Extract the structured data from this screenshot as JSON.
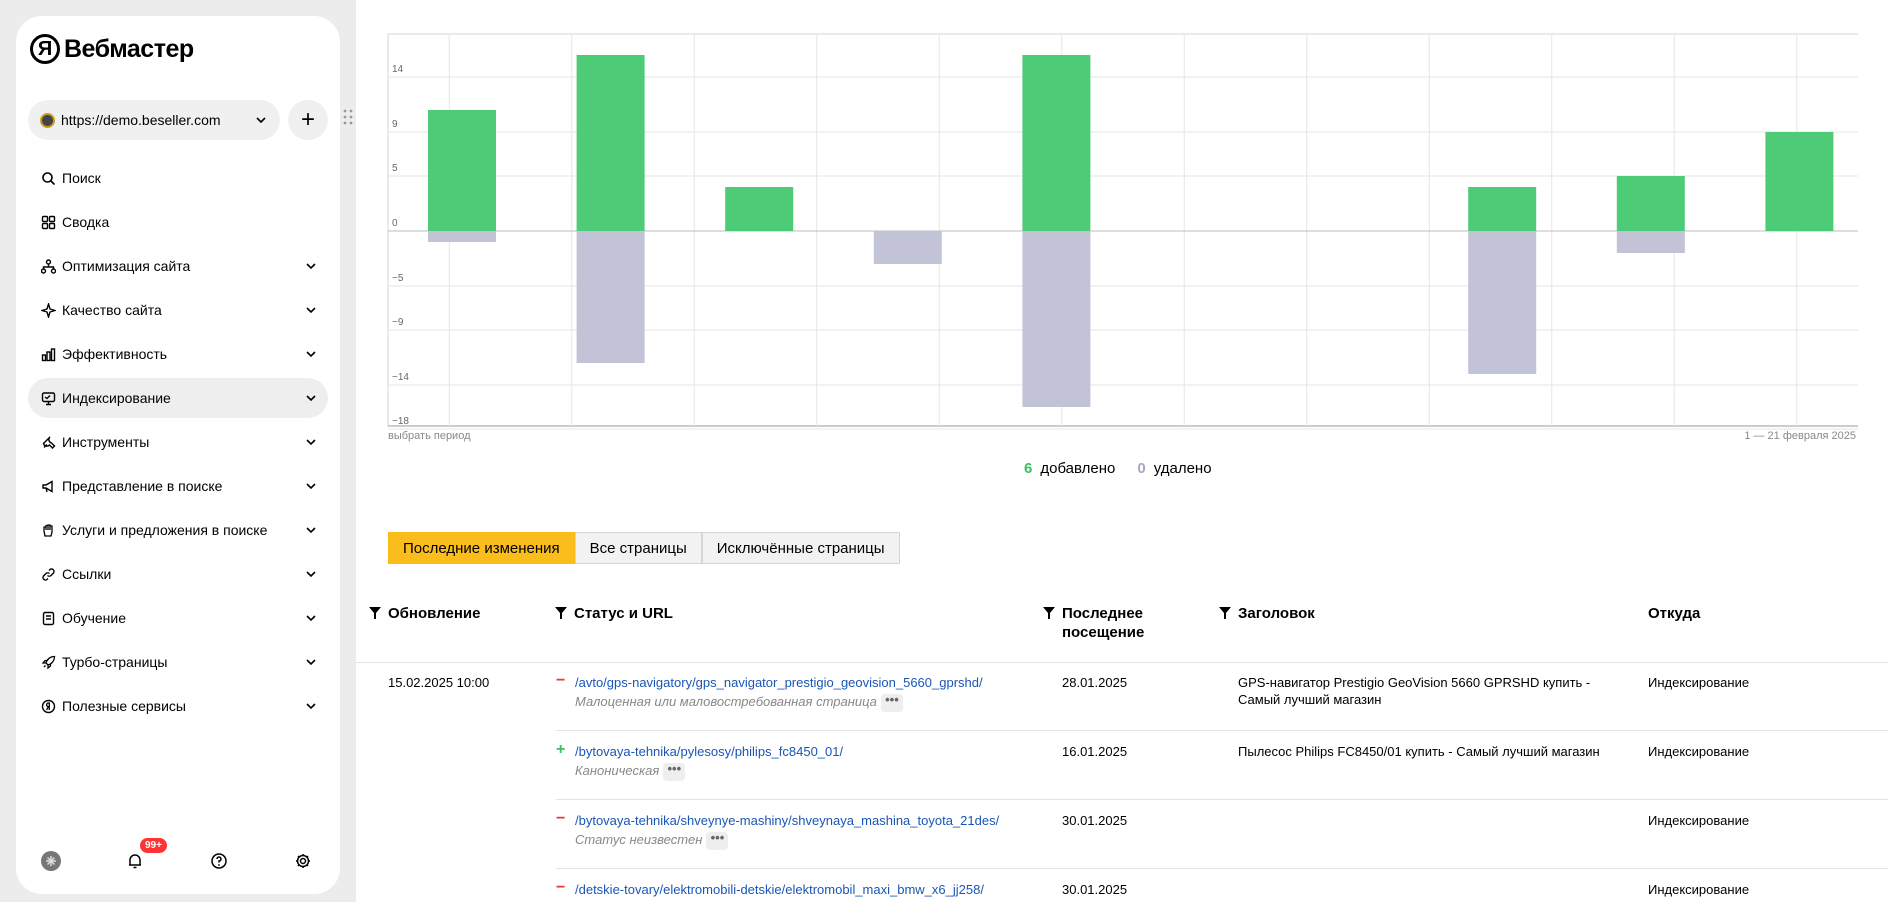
{
  "app": {
    "logo_letter": "Я",
    "logo_text": "Вебмастер"
  },
  "site": {
    "url": "https://demo.beseller.com",
    "add_label": "+"
  },
  "nav": [
    {
      "label": "Поиск",
      "icon": "search-icon",
      "has_chevron": false
    },
    {
      "label": "Сводка",
      "icon": "grid-icon",
      "has_chevron": false
    },
    {
      "label": "Оптимизация сайта",
      "icon": "structure-icon",
      "has_chevron": true
    },
    {
      "label": "Качество сайта",
      "icon": "sparkle-icon",
      "has_chevron": true
    },
    {
      "label": "Эффективность",
      "icon": "bars-icon",
      "has_chevron": true
    },
    {
      "label": "Индексирование",
      "icon": "monitor-icon",
      "has_chevron": true,
      "active": true
    },
    {
      "label": "Инструменты",
      "icon": "wrench-icon",
      "has_chevron": true
    },
    {
      "label": "Представление в поиске",
      "icon": "megaphone-icon",
      "has_chevron": true
    },
    {
      "label": "Услуги и предложения в поиске",
      "icon": "hand-icon",
      "has_chevron": true
    },
    {
      "label": "Ссылки",
      "icon": "link-icon",
      "has_chevron": true
    },
    {
      "label": "Обучение",
      "icon": "book-icon",
      "has_chevron": true
    },
    {
      "label": "Турбо-страницы",
      "icon": "rocket-icon",
      "has_chevron": true
    },
    {
      "label": "Полезные сервисы",
      "icon": "yandex-icon",
      "has_chevron": true
    }
  ],
  "bottom": {
    "notifications_badge": "99+"
  },
  "chart_data": {
    "type": "bar",
    "y_ticks": [
      "14",
      "9",
      "5",
      "0",
      "−5",
      "−9",
      "−14",
      "−18"
    ],
    "y_tick_values": [
      14,
      9,
      5,
      0,
      -5,
      -9,
      -14,
      -18
    ],
    "ylim": [
      -18,
      18
    ],
    "series": [
      {
        "name": "добавлено",
        "color": "#4ecb77",
        "values": [
          11,
          16,
          4,
          0,
          16,
          0,
          4,
          5,
          9,
          6
        ]
      },
      {
        "name": "удалено",
        "color": "#c2c3d6",
        "values": [
          -1,
          -12,
          0,
          -3,
          -16,
          0,
          -13,
          -2,
          0,
          0
        ]
      }
    ],
    "bar_slots": [
      0,
      1,
      2,
      3,
      4,
      6,
      7,
      8,
      9
    ],
    "footer_left": "выбрать период",
    "footer_right": "1 — 21 февраля 2025"
  },
  "legend": {
    "added_count": "6",
    "added_label": "добавлено",
    "removed_count": "0",
    "removed_label": "удалено"
  },
  "tabs": [
    "Последние изменения",
    "Все страницы",
    "Исключённые страницы"
  ],
  "table": {
    "headers": {
      "updated": "Обновление",
      "status_url": "Статус и URL",
      "last_visit_1": "Последнее",
      "last_visit_2": "посещение",
      "title": "Заголовок",
      "source": "Откуда"
    },
    "rows": [
      {
        "date": "15.02.2025 10:00",
        "sign": "−",
        "url": "/avto/gps-navigatory/gps_navigator_prestigio_geovision_5660_gprshd/",
        "status": "Малоценная или маловостребованная страница",
        "last_visit": "28.01.2025",
        "title_1": "GPS-навигатор Prestigio GeoVision 5660 GPRSHD купить -",
        "title_2": "Самый лучший магазин",
        "source": "Индексирование"
      },
      {
        "date": "",
        "sign": "+",
        "url": "/bytovaya-tehnika/pylesosy/philips_fc8450_01/",
        "status": "Каноническая",
        "last_visit": "16.01.2025",
        "title_1": "Пылесос Philips FC8450/01 купить - Самый лучший магазин",
        "title_2": "",
        "source": "Индексирование"
      },
      {
        "date": "",
        "sign": "−",
        "url": "/bytovaya-tehnika/shveynye-mashiny/shveynaya_mashina_toyota_21des/",
        "status": "Статус неизвестен",
        "last_visit": "30.01.2025",
        "title_1": "",
        "title_2": "",
        "source": "Индексирование"
      },
      {
        "date": "",
        "sign": "−",
        "url": "/detskie-tovary/elektromobili-detskie/elektromobil_maxi_bmw_x6_jj258/",
        "status": "",
        "last_visit": "30.01.2025",
        "title_1": "",
        "title_2": "",
        "source": "Индексирование"
      }
    ]
  },
  "dots_label": "•••"
}
